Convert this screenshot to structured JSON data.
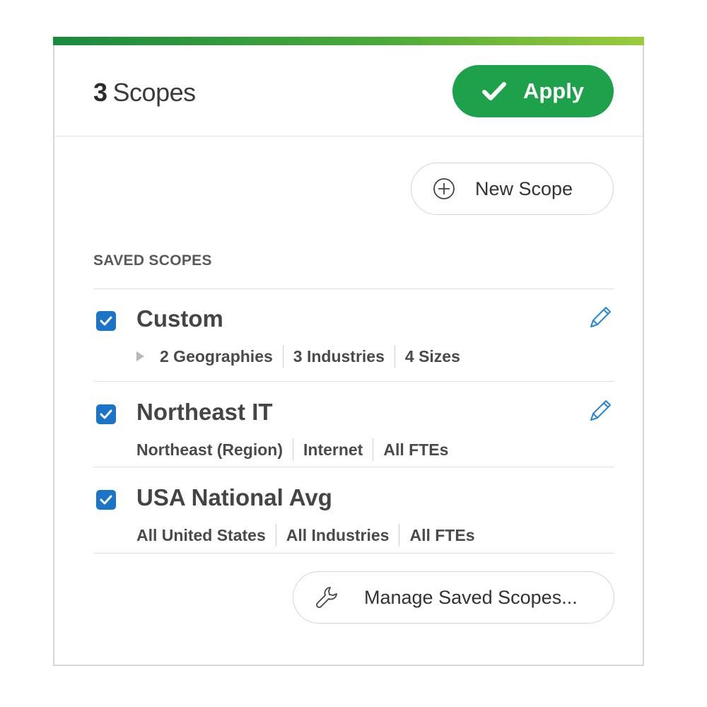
{
  "header": {
    "scope_count": "3",
    "scope_label": "Scopes",
    "apply_label": "Apply"
  },
  "new_scope_label": "New Scope",
  "section_label": "SAVED SCOPES",
  "scopes": [
    {
      "name": "Custom",
      "checked": true,
      "expandable": true,
      "tags": [
        "2 Geographies",
        "3 Industries",
        "4 Sizes"
      ]
    },
    {
      "name": "Northeast IT",
      "checked": true,
      "expandable": false,
      "tags": [
        "Northeast (Region)",
        "Internet",
        "All FTEs"
      ]
    },
    {
      "name": "USA National Avg",
      "checked": true,
      "expandable": false,
      "tags": [
        "All United States",
        "All Industries",
        "All FTEs"
      ]
    }
  ],
  "manage_label": "Manage Saved Scopes...",
  "colors": {
    "accent_green": "#1ea14b",
    "checkbox_blue": "#1b74c5",
    "edit_icon_blue": "#2a86d6"
  },
  "icons": {
    "apply": "checkmark-icon",
    "new_scope": "plus-circle-icon",
    "expand": "triangle-right-icon",
    "edit": "pencil-icon",
    "manage": "wrench-icon"
  }
}
